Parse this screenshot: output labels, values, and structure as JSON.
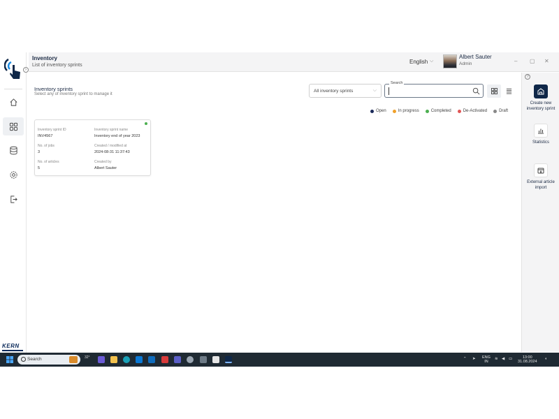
{
  "header": {
    "title": "Inventory",
    "subtitle": "List of inventory sprints",
    "language": "English",
    "user_name": "Albert Sauter",
    "user_role": "Admin"
  },
  "content": {
    "section_title": "Inventory sprints",
    "section_subtitle": "Select any of inventory sprint to manage it",
    "filter_value": "All inventory sprints",
    "search_label": "Search",
    "search_value": "",
    "legend": [
      {
        "label": "Open",
        "color": "#1b2a5a"
      },
      {
        "label": "In progress",
        "color": "#f0a02a"
      },
      {
        "label": "Completed",
        "color": "#4caf50"
      },
      {
        "label": "De-Activated",
        "color": "#e05555"
      },
      {
        "label": "Draft",
        "color": "#888888"
      }
    ]
  },
  "card": {
    "status_color": "#4caf50",
    "id_label": "Inventory sprint ID",
    "id_value": "INV4567",
    "name_label": "Inventory sprint name",
    "name_value": "Inventory end of year 2023",
    "jobs_label": "No. of jobs",
    "jobs_value": "3",
    "modified_label": "Created / modified at",
    "modified_value": "2024-08-31 11:37:43",
    "articles_label": "No. of articles",
    "articles_value": "5",
    "created_by_label": "Created by",
    "created_by_value": "Albert Sauter"
  },
  "actions": {
    "create_label": "Create new inventory sprint",
    "statistics_label": "Statistics",
    "import_label": "External article import"
  },
  "brand": "KERN",
  "taskbar": {
    "search_placeholder": "Search",
    "weather": "32°",
    "lang_top": "ENG",
    "lang_bottom": "IN",
    "time": "13:00",
    "date": "31.08.2024"
  },
  "icons": {
    "nav": [
      "home-icon",
      "grid-icon",
      "database-icon",
      "gear-icon",
      "logout-icon"
    ]
  }
}
